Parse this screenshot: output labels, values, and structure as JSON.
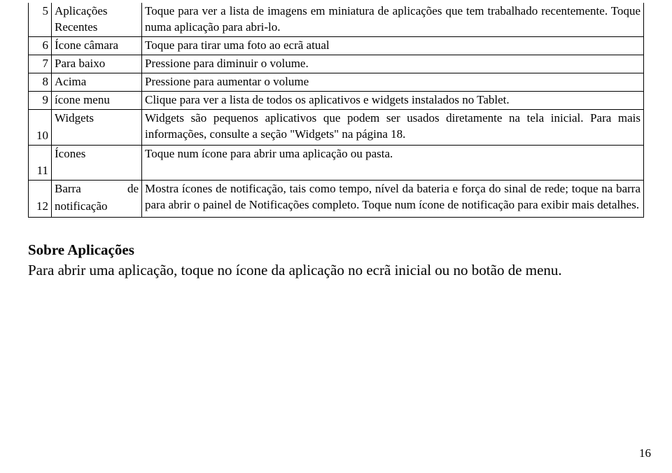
{
  "rows": [
    {
      "num": "5",
      "label": "Aplicações Recentes",
      "desc": "Toque para ver a lista de imagens em miniatura de aplicações que tem trabalhado recentemente. Toque numa aplicação para abri-lo."
    },
    {
      "num": "6",
      "label": "Ícone câmara",
      "desc": "Toque para tirar uma foto ao ecrã atual"
    },
    {
      "num": "7",
      "label": "Para baixo",
      "desc": "Pressione para diminuir o volume."
    },
    {
      "num": "8",
      "label": "Acima",
      "desc": "Pressione para aumentar o volume"
    },
    {
      "num": "9",
      "label": "ícone menu",
      "desc": "Clique para ver a lista de todos os aplicativos e widgets instalados no Tablet."
    },
    {
      "num": "10",
      "label": "Widgets",
      "desc": "Widgets são pequenos aplicativos que podem ser usados diretamente na tela inicial. Para mais informações, consulte a seção \"Widgets\" na página 18."
    },
    {
      "num": "11",
      "label": "Ícones",
      "desc": "Toque num ícone para abrir uma aplicação ou pasta."
    },
    {
      "num": "12",
      "label": "Barra de notificação",
      "desc": "Mostra ícones de notificação, tais como tempo, nível da bateria e força do sinal de rede; toque na barra para abrir o painel de Notificações completo. Toque num ícone de notificação para exibir mais detalhes."
    }
  ],
  "row12": {
    "label_line1": "Barra",
    "label_line2": "notificação",
    "de": "de"
  },
  "section": {
    "title": "Sobre Aplicações",
    "body": "Para abrir uma aplicação, toque no ícone da aplicação no ecrã inicial ou no botão de menu."
  },
  "page_number": "16"
}
